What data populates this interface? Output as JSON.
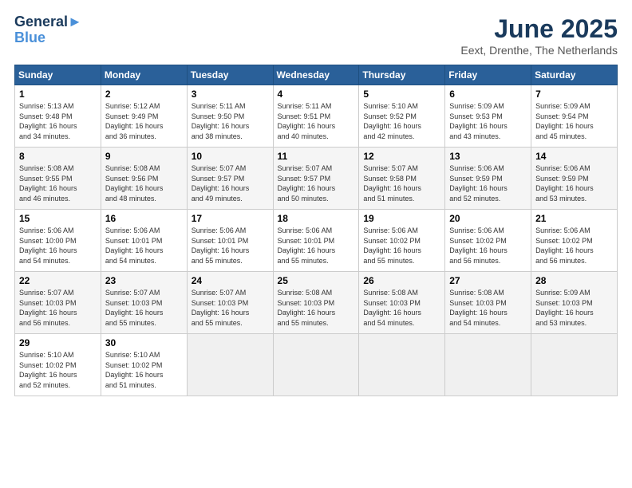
{
  "header": {
    "logo_line1": "General",
    "logo_line2": "Blue",
    "month_title": "June 2025",
    "subtitle": "Eext, Drenthe, The Netherlands"
  },
  "weekdays": [
    "Sunday",
    "Monday",
    "Tuesday",
    "Wednesday",
    "Thursday",
    "Friday",
    "Saturday"
  ],
  "weeks": [
    [
      {
        "day": "1",
        "info": "Sunrise: 5:13 AM\nSunset: 9:48 PM\nDaylight: 16 hours\nand 34 minutes."
      },
      {
        "day": "2",
        "info": "Sunrise: 5:12 AM\nSunset: 9:49 PM\nDaylight: 16 hours\nand 36 minutes."
      },
      {
        "day": "3",
        "info": "Sunrise: 5:11 AM\nSunset: 9:50 PM\nDaylight: 16 hours\nand 38 minutes."
      },
      {
        "day": "4",
        "info": "Sunrise: 5:11 AM\nSunset: 9:51 PM\nDaylight: 16 hours\nand 40 minutes."
      },
      {
        "day": "5",
        "info": "Sunrise: 5:10 AM\nSunset: 9:52 PM\nDaylight: 16 hours\nand 42 minutes."
      },
      {
        "day": "6",
        "info": "Sunrise: 5:09 AM\nSunset: 9:53 PM\nDaylight: 16 hours\nand 43 minutes."
      },
      {
        "day": "7",
        "info": "Sunrise: 5:09 AM\nSunset: 9:54 PM\nDaylight: 16 hours\nand 45 minutes."
      }
    ],
    [
      {
        "day": "8",
        "info": "Sunrise: 5:08 AM\nSunset: 9:55 PM\nDaylight: 16 hours\nand 46 minutes."
      },
      {
        "day": "9",
        "info": "Sunrise: 5:08 AM\nSunset: 9:56 PM\nDaylight: 16 hours\nand 48 minutes."
      },
      {
        "day": "10",
        "info": "Sunrise: 5:07 AM\nSunset: 9:57 PM\nDaylight: 16 hours\nand 49 minutes."
      },
      {
        "day": "11",
        "info": "Sunrise: 5:07 AM\nSunset: 9:57 PM\nDaylight: 16 hours\nand 50 minutes."
      },
      {
        "day": "12",
        "info": "Sunrise: 5:07 AM\nSunset: 9:58 PM\nDaylight: 16 hours\nand 51 minutes."
      },
      {
        "day": "13",
        "info": "Sunrise: 5:06 AM\nSunset: 9:59 PM\nDaylight: 16 hours\nand 52 minutes."
      },
      {
        "day": "14",
        "info": "Sunrise: 5:06 AM\nSunset: 9:59 PM\nDaylight: 16 hours\nand 53 minutes."
      }
    ],
    [
      {
        "day": "15",
        "info": "Sunrise: 5:06 AM\nSunset: 10:00 PM\nDaylight: 16 hours\nand 54 minutes."
      },
      {
        "day": "16",
        "info": "Sunrise: 5:06 AM\nSunset: 10:01 PM\nDaylight: 16 hours\nand 54 minutes."
      },
      {
        "day": "17",
        "info": "Sunrise: 5:06 AM\nSunset: 10:01 PM\nDaylight: 16 hours\nand 55 minutes."
      },
      {
        "day": "18",
        "info": "Sunrise: 5:06 AM\nSunset: 10:01 PM\nDaylight: 16 hours\nand 55 minutes."
      },
      {
        "day": "19",
        "info": "Sunrise: 5:06 AM\nSunset: 10:02 PM\nDaylight: 16 hours\nand 55 minutes."
      },
      {
        "day": "20",
        "info": "Sunrise: 5:06 AM\nSunset: 10:02 PM\nDaylight: 16 hours\nand 56 minutes."
      },
      {
        "day": "21",
        "info": "Sunrise: 5:06 AM\nSunset: 10:02 PM\nDaylight: 16 hours\nand 56 minutes."
      }
    ],
    [
      {
        "day": "22",
        "info": "Sunrise: 5:07 AM\nSunset: 10:03 PM\nDaylight: 16 hours\nand 56 minutes."
      },
      {
        "day": "23",
        "info": "Sunrise: 5:07 AM\nSunset: 10:03 PM\nDaylight: 16 hours\nand 55 minutes."
      },
      {
        "day": "24",
        "info": "Sunrise: 5:07 AM\nSunset: 10:03 PM\nDaylight: 16 hours\nand 55 minutes."
      },
      {
        "day": "25",
        "info": "Sunrise: 5:08 AM\nSunset: 10:03 PM\nDaylight: 16 hours\nand 55 minutes."
      },
      {
        "day": "26",
        "info": "Sunrise: 5:08 AM\nSunset: 10:03 PM\nDaylight: 16 hours\nand 54 minutes."
      },
      {
        "day": "27",
        "info": "Sunrise: 5:08 AM\nSunset: 10:03 PM\nDaylight: 16 hours\nand 54 minutes."
      },
      {
        "day": "28",
        "info": "Sunrise: 5:09 AM\nSunset: 10:03 PM\nDaylight: 16 hours\nand 53 minutes."
      }
    ],
    [
      {
        "day": "29",
        "info": "Sunrise: 5:10 AM\nSunset: 10:02 PM\nDaylight: 16 hours\nand 52 minutes."
      },
      {
        "day": "30",
        "info": "Sunrise: 5:10 AM\nSunset: 10:02 PM\nDaylight: 16 hours\nand 51 minutes."
      },
      null,
      null,
      null,
      null,
      null
    ]
  ]
}
